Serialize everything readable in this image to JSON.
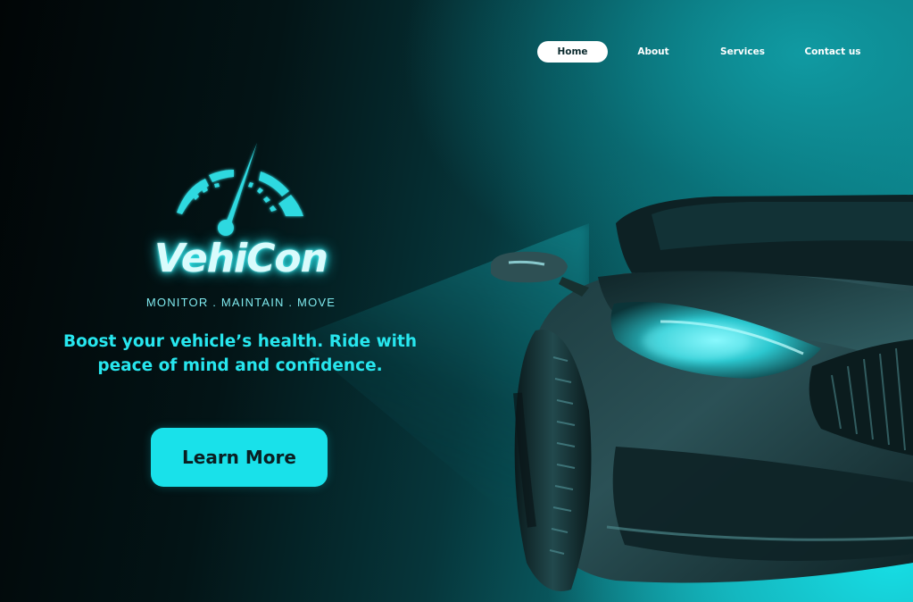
{
  "nav": {
    "items": [
      {
        "label": "Home",
        "active": true
      },
      {
        "label": "About",
        "active": false
      },
      {
        "label": "Services",
        "active": false
      },
      {
        "label": "Contact us",
        "active": false
      }
    ]
  },
  "hero": {
    "brand": "VehiCon",
    "tagline": "MONITOR . MAINTAIN . MOVE",
    "headline_line1": "Boost your vehicle’s health. Ride with",
    "headline_line2": "peace of mind and confidence.",
    "cta_label": "Learn More"
  },
  "icons": {
    "logo": "speedometer-gauge-icon",
    "hero_image": "car-front-image"
  },
  "colors": {
    "accent": "#19e1ea",
    "headline": "#27e6ee",
    "tagline": "#7fe9ee",
    "background_dark": "#031012",
    "background_teal": "#12a7ae"
  }
}
